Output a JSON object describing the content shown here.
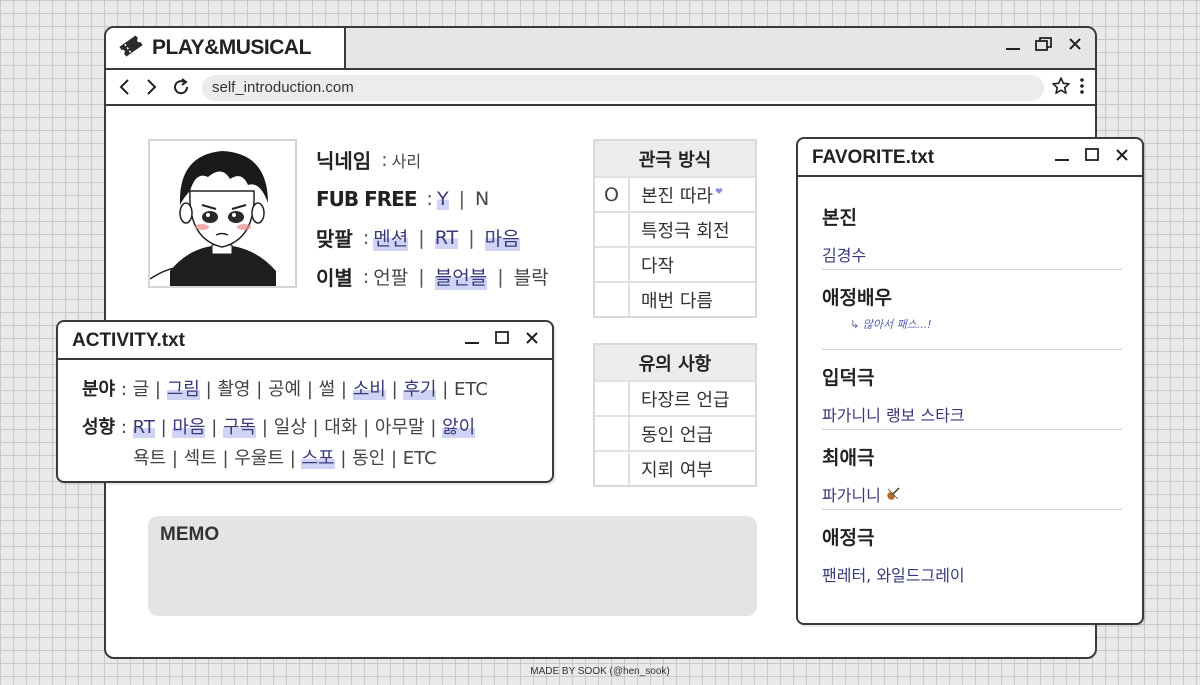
{
  "browser": {
    "tab_title": "PLAY&MUSICAL",
    "url": "self_introduction.com"
  },
  "profile": {
    "nickname_label": "닉네임",
    "nickname_value": "사리",
    "fub_label": "FUB FREE",
    "fub_y": "Y",
    "fub_n": "N",
    "follow_label": "맞팔",
    "follow_opt1": "멘션",
    "follow_opt2": "RT",
    "follow_opt3": "마음",
    "farewell_label": "이별",
    "farewell_opt1": "언팔",
    "farewell_opt2": "블언블",
    "farewell_opt3": "블락"
  },
  "viewing": {
    "title": "관극 방식",
    "rows": [
      {
        "mark": "O",
        "text": "본진 따라"
      },
      {
        "mark": "",
        "text": "특정극 회전"
      },
      {
        "mark": "",
        "text": "다작"
      },
      {
        "mark": "",
        "text": "매번 다름"
      }
    ]
  },
  "caution": {
    "title": "유의 사항",
    "rows": [
      {
        "mark": "",
        "text": "타장르 언급"
      },
      {
        "mark": "",
        "text": "동인 언급"
      },
      {
        "mark": "",
        "text": "지뢰 여부"
      }
    ]
  },
  "activity": {
    "title": "ACTIVITY.txt",
    "field_label": "분야",
    "fields": [
      "글",
      "그림",
      "촬영",
      "공예",
      "썰",
      "소비",
      "후기",
      "ETC"
    ],
    "tendency_label": "성향",
    "tendency_line1": [
      "RT",
      "마음",
      "구독",
      "일상",
      "대화",
      "아무말",
      "앓이"
    ],
    "tendency_line2": [
      "욕트",
      "섹트",
      "우울트",
      "스포",
      "동인",
      "ETC"
    ]
  },
  "memo": {
    "title": "MEMO"
  },
  "favorite": {
    "title": "FAVORITE.txt",
    "bonjin_label": "본진",
    "bonjin_value": "김경수",
    "actor_label": "애정배우",
    "actor_note": "많아서 패스...!",
    "entry_label": "입덕극",
    "entry_value": "파가니니 랭보 스타크",
    "best_label": "최애극",
    "best_value": "파가니니",
    "loved_label": "애정극",
    "loved_value": "팬레터, 와일드그레이"
  },
  "footer": {
    "credit": "MADE BY SOOK (@hen_sook)"
  },
  "colors": {
    "frame": "#3a3a3a",
    "highlight": "#96a0e6",
    "accent_text": "#3a3a7a"
  }
}
